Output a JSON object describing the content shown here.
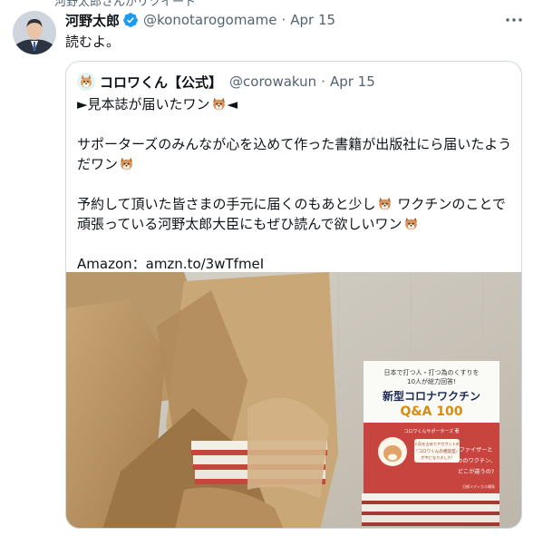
{
  "context_text": "河野太郎さんがリツイート",
  "tweet": {
    "author_name": "河野太郎",
    "handle": "@konotarogomame",
    "separator": "·",
    "date": "Apr 15",
    "text": "読むよ。"
  },
  "quoted_tweet": {
    "author_name": "コロワくん【公式】",
    "handle": "@corowakun",
    "separator": "·",
    "date": "Apr 15",
    "line1_prefix": "►見本誌が届いたワン",
    "line1_suffix": "◄",
    "para2": "サポーターズのみんなが心を込めて作った書籍が出版社にら届いたようだワン",
    "para3a": "予約して頂いた皆さまの手元に届くのもあと少し",
    "para3b": " ワクチンのことで頑張っている河野太郎大臣にもぜひ読んで欲しいワン",
    "amazon": "Amazon：amzn.to/3wTfmeI"
  },
  "book_cover": {
    "top_line1": "日本で打つ人・打つ為のくすりを",
    "top_line2": "10人が総力回答!",
    "title": "新型コロナワクチン",
    "qa": "Q&A 100",
    "authors": "コロワくんサポーターズ 著",
    "note1": "人気を占めてアカウントの",
    "note2": "『コロワくんの相談室』",
    "note3": "が本になりました!",
    "callout1": "ファイザーと",
    "callout2": "アストラゼネカのワクチン、",
    "callout3": "どこが違うの?",
    "publisher": "日経メディカル開発"
  },
  "colors": {
    "verified": "#1d9bf0",
    "muted": "#536471",
    "border": "#cfd9de",
    "book_red": "#c8453f"
  },
  "icons": {
    "verified": "verified-badge-icon",
    "more": "more-options-icon",
    "dog": "dog-face-icon"
  }
}
